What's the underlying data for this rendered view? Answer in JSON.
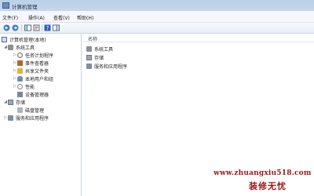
{
  "window": {
    "title": "计算机管理"
  },
  "menu": {
    "file": "文件(F)",
    "action": "操作(A)",
    "view": "查看(V)",
    "help": "帮助(H)"
  },
  "toolbar": {
    "icons": [
      "back-arrow-icon",
      "forward-arrow-icon",
      "console-tree-icon",
      "properties-icon",
      "help-icon",
      "show-hide-icon"
    ]
  },
  "tree": {
    "root": "计算机管理(本地)",
    "system_tools": "系统工具",
    "task_scheduler": "任务计划程序",
    "event_viewer": "事件查看器",
    "shared_folders": "共享文件夹",
    "local_users": "本地用户和组",
    "performance": "性能",
    "device_manager": "设备管理器",
    "storage": "存储",
    "disk_management": "磁盘管理",
    "services_apps": "服务和应用程序"
  },
  "list": {
    "column_name": "名称",
    "items": [
      "系统工具",
      "存储",
      "服务和应用程序"
    ]
  },
  "watermark": {
    "url": "www.zhuangxiu518.com",
    "name": "装修无忧"
  }
}
